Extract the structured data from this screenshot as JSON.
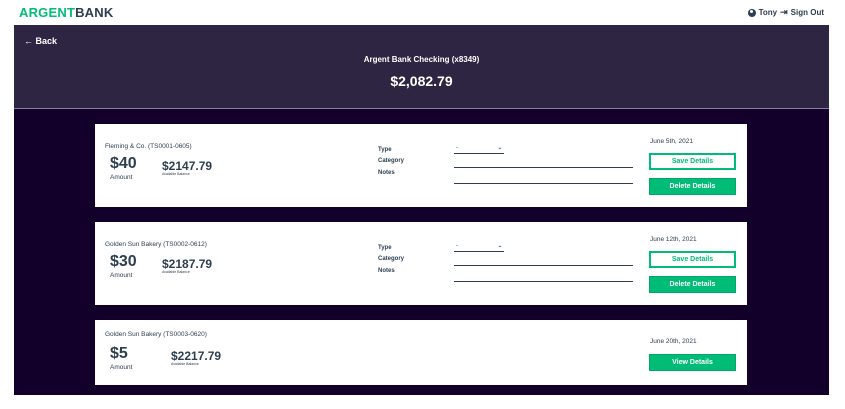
{
  "nav": {
    "logo_accent": "ARGENT",
    "logo_rest": "BANK",
    "user_name": "Tony",
    "sign_out": "Sign Out"
  },
  "account": {
    "back_label": "← Back",
    "title": "Argent Bank Checking (x8349)",
    "balance": "$2,082.79"
  },
  "form_labels": {
    "type": "Type",
    "category": "Category",
    "notes": "Notes"
  },
  "transactions": [
    {
      "payee": "Fleming & Co. (TS0001-0605)",
      "amount": "$40",
      "amount_label": "Amount",
      "available_balance": "$2147.79",
      "available_label": "Available Balance",
      "date": "June 5th, 2021",
      "type_value": "-",
      "save_label": "Save Details",
      "delete_label": "Delete Details"
    },
    {
      "payee": "Golden Sun Bakery (TS0002-0612)",
      "amount": "$30",
      "amount_label": "Amount",
      "available_balance": "$2187.79",
      "available_label": "Available Balance",
      "date": "June 12th, 2021",
      "type_value": "-",
      "save_label": "Save Details",
      "delete_label": "Delete Details"
    },
    {
      "payee": "Golden Sun Bakery (TS0003-0620)",
      "amount": "$5",
      "amount_label": "Amount",
      "available_balance": "$2217.79",
      "available_label": "Available Balance",
      "date": "June 20th, 2021",
      "view_label": "View Details"
    }
  ],
  "colors": {
    "brand_green": "#00bc77",
    "header_bg": "#2d2541",
    "page_bg": "#12002b",
    "text": "#2c3e50"
  }
}
